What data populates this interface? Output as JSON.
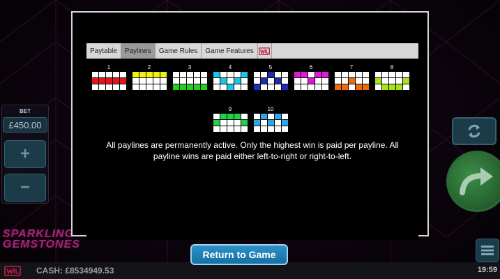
{
  "game": {
    "logo_text": "SPARKLING GEMSTONES"
  },
  "bet": {
    "title": "BET",
    "value": "£450.00",
    "increase_label": "+",
    "decrease_label": "−"
  },
  "footer": {
    "cash": "CASH: £8534949.53",
    "clock": "19:59"
  },
  "dialog": {
    "tabs": [
      {
        "label": "Paytable",
        "active": false
      },
      {
        "label": "Paylines",
        "active": true
      },
      {
        "label": "Game Rules",
        "active": false
      },
      {
        "label": "Game Features",
        "active": false
      }
    ],
    "description": "All paylines are permanently active. Only the highest win is paid per payline. All payline wins are paid either left-to-right or right-to-left.",
    "return_label": "Return to Game",
    "paylines": [
      {
        "number": "1",
        "color": "#e8141c",
        "cells": [
          [
            1,
            0
          ],
          [
            1,
            1
          ],
          [
            1,
            2
          ],
          [
            1,
            3
          ],
          [
            1,
            4
          ]
        ]
      },
      {
        "number": "2",
        "color": "#f0f012",
        "cells": [
          [
            0,
            0
          ],
          [
            0,
            1
          ],
          [
            0,
            2
          ],
          [
            0,
            3
          ],
          [
            0,
            4
          ]
        ]
      },
      {
        "number": "3",
        "color": "#22d022",
        "cells": [
          [
            2,
            0
          ],
          [
            2,
            1
          ],
          [
            2,
            2
          ],
          [
            2,
            3
          ],
          [
            2,
            4
          ]
        ]
      },
      {
        "number": "4",
        "color": "#16c8e6",
        "cells": [
          [
            0,
            0
          ],
          [
            1,
            1
          ],
          [
            2,
            2
          ],
          [
            1,
            3
          ],
          [
            0,
            4
          ]
        ]
      },
      {
        "number": "5",
        "color": "#1c2eb4",
        "cells": [
          [
            2,
            0
          ],
          [
            1,
            1
          ],
          [
            0,
            2
          ],
          [
            1,
            3
          ],
          [
            2,
            4
          ]
        ]
      },
      {
        "number": "6",
        "color": "#e018d8",
        "cells": [
          [
            0,
            0
          ],
          [
            0,
            1
          ],
          [
            1,
            2
          ],
          [
            0,
            3
          ],
          [
            0,
            4
          ]
        ]
      },
      {
        "number": "7",
        "color": "#f06a10",
        "cells": [
          [
            2,
            0
          ],
          [
            2,
            1
          ],
          [
            1,
            2
          ],
          [
            2,
            3
          ],
          [
            2,
            4
          ]
        ]
      },
      {
        "number": "8",
        "color": "#a8e418",
        "cells": [
          [
            1,
            0
          ],
          [
            2,
            1
          ],
          [
            2,
            2
          ],
          [
            2,
            3
          ],
          [
            1,
            4
          ]
        ]
      },
      {
        "number": "9",
        "color": "#22d04a",
        "cells": [
          [
            1,
            0
          ],
          [
            0,
            1
          ],
          [
            0,
            2
          ],
          [
            0,
            3
          ],
          [
            1,
            4
          ]
        ]
      },
      {
        "number": "10",
        "color": "#2aa8e8",
        "cells": [
          [
            1,
            0
          ],
          [
            0,
            1
          ],
          [
            1,
            2
          ],
          [
            0,
            3
          ],
          [
            1,
            4
          ]
        ]
      }
    ]
  }
}
